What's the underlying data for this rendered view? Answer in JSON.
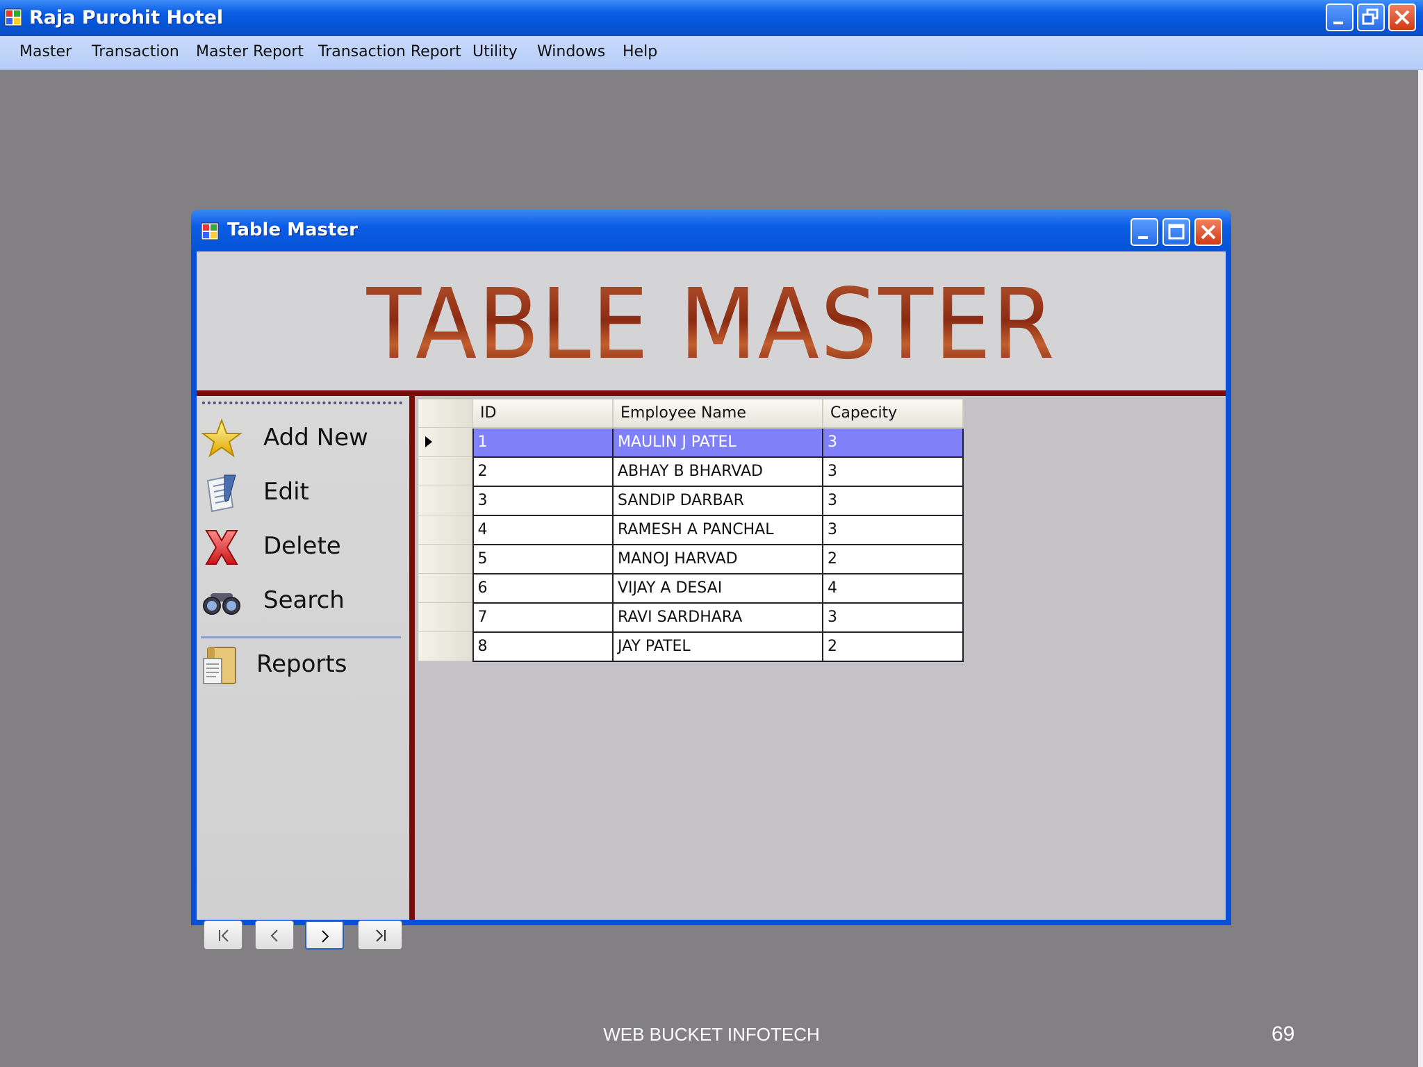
{
  "app": {
    "title": "Raja Purohit Hotel",
    "menu": [
      "Master",
      "Transaction",
      "Master Report",
      "Transaction Report",
      "Utility",
      "Windows",
      "Help"
    ]
  },
  "child": {
    "title": "Table Master",
    "banner": "TABLE MASTER",
    "actions": [
      {
        "label": "Add New",
        "icon": "star-icon"
      },
      {
        "label": "Edit",
        "icon": "edit-notepad-icon"
      },
      {
        "label": "Delete",
        "icon": "red-x-icon"
      },
      {
        "label": "Search",
        "icon": "binoculars-icon"
      }
    ],
    "reports_label": "Reports",
    "nav": {
      "first": "first-record",
      "prev": "previous-record",
      "next": "next-record",
      "last": "last-record"
    },
    "grid": {
      "columns": [
        "ID",
        "Employee Name",
        "Capecity"
      ],
      "rows": [
        [
          "1",
          "MAULIN J PATEL",
          "3"
        ],
        [
          "2",
          "ABHAY B BHARVAD",
          "3"
        ],
        [
          "3",
          "SANDIP DARBAR",
          "3"
        ],
        [
          "4",
          "RAMESH A PANCHAL",
          "3"
        ],
        [
          "5",
          "MANOJ HARVAD",
          "2"
        ],
        [
          "6",
          "VIJAY A DESAI",
          "4"
        ],
        [
          "7",
          "RAVI SARDHARA",
          "3"
        ],
        [
          "8",
          "JAY PATEL",
          "2"
        ]
      ],
      "selected_row": 0
    }
  },
  "footer": {
    "text": "WEB BUCKET INFOTECH",
    "page": "69"
  },
  "colors": {
    "titlebar": "#0553d6",
    "accent_maroon": "#7b0c0c",
    "selection": "#8080f8",
    "desktop": "#828083"
  }
}
